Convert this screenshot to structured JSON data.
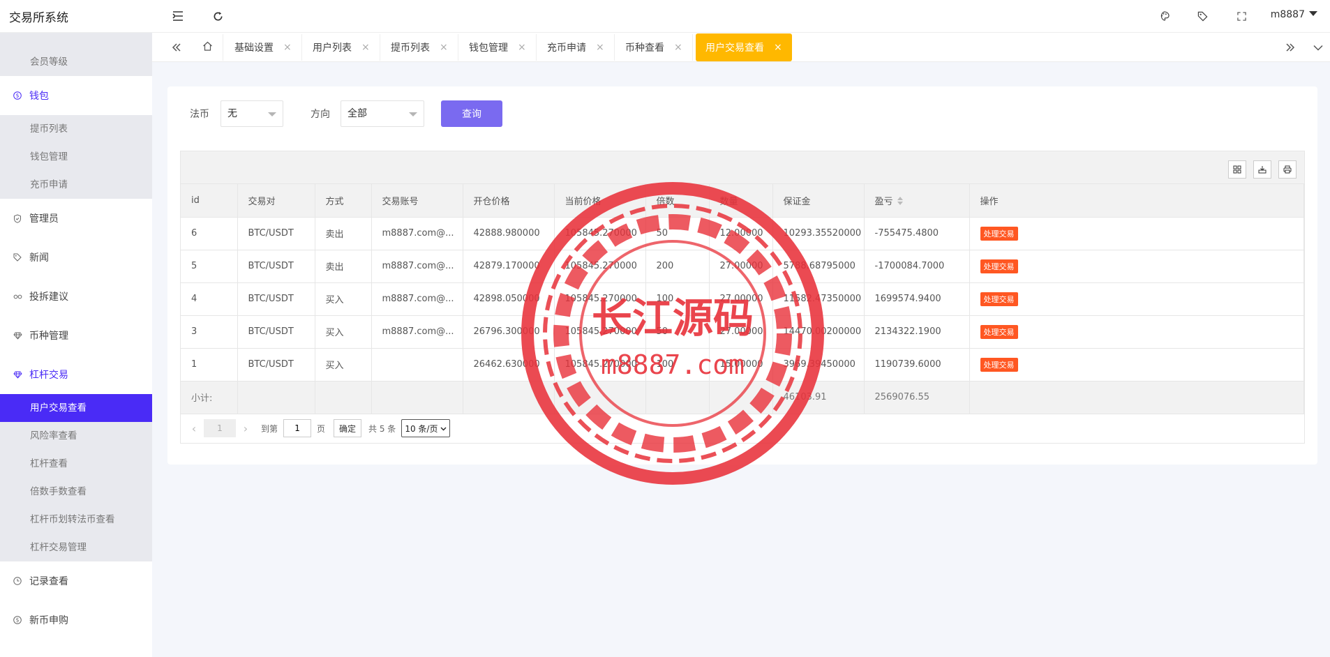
{
  "app": {
    "title": "交易所系统"
  },
  "user": {
    "name": "m8887"
  },
  "sidebar": {
    "top_items": [
      "会员等级"
    ],
    "wallet": {
      "label": "钱包",
      "children": [
        "提币列表",
        "钱包管理",
        "充币申请"
      ]
    },
    "items_mid": [
      "管理员",
      "新闻",
      "投拆建议",
      "币种管理"
    ],
    "leverage": {
      "label": "杠杆交易",
      "children": [
        "用户交易查看",
        "风险率查看",
        "杠杆查看",
        "倍数手数查看",
        "杠杆币划转法币查看",
        "杠杆交易管理"
      ]
    },
    "items_bottom": [
      "记录查看",
      "新币申购"
    ]
  },
  "tabs": [
    "基础设置",
    "用户列表",
    "提币列表",
    "钱包管理",
    "充币申请",
    "币种查看",
    "用户交易查看"
  ],
  "filter": {
    "fiat_label": "法币",
    "fiat_value": "无",
    "direction_label": "方向",
    "direction_value": "全部",
    "query_button": "查询"
  },
  "table": {
    "columns": [
      "id",
      "交易对",
      "方式",
      "交易账号",
      "开仓价格",
      "当前价格",
      "倍数",
      "数量",
      "保证金",
      "盈亏",
      "操作"
    ],
    "rows": [
      [
        "6",
        "BTC/USDT",
        "卖出",
        "m8887.com@...",
        "42888.980000",
        "105845.270000",
        "50",
        "12.00000",
        "10293.35520000",
        "-755475.4800",
        "处理交易"
      ],
      [
        "5",
        "BTC/USDT",
        "卖出",
        "m8887.com@...",
        "42879.170000",
        "105845.270000",
        "200",
        "27.00000",
        "5788.68795000",
        "-1700084.7000",
        "处理交易"
      ],
      [
        "4",
        "BTC/USDT",
        "买入",
        "m8887.com@...",
        "42898.050000",
        "105845.270000",
        "100",
        "27.00000",
        "11582.47350000",
        "1699574.9400",
        "处理交易"
      ],
      [
        "3",
        "BTC/USDT",
        "买入",
        "m8887.com@...",
        "26796.300000",
        "105845.270000",
        "50",
        "27.00000",
        "14470.00200000",
        "2134322.1900",
        "处理交易"
      ],
      [
        "1",
        "BTC/USDT",
        "买入",
        "",
        "26462.630000",
        "105845.270000",
        "100",
        "15.00000",
        "3969.39450000",
        "1190739.6000",
        "处理交易"
      ]
    ],
    "total_label": "小计:",
    "total_margin": "46103.91",
    "total_pnl": "2569076.55"
  },
  "pager": {
    "current": "1",
    "goto_label": "到第",
    "goto_value": "1",
    "page_label": "页",
    "confirm": "确定",
    "total": "共 5 条",
    "page_size": "10 条/页"
  },
  "watermark": {
    "line1": "长江源码",
    "line2": "m8887.com"
  }
}
